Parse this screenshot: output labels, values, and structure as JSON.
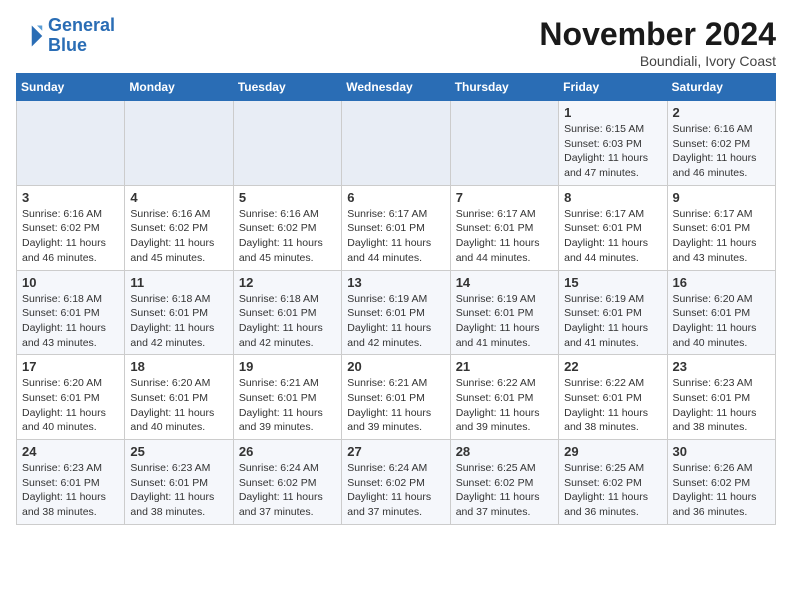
{
  "header": {
    "logo_line1": "General",
    "logo_line2": "Blue",
    "month": "November 2024",
    "location": "Boundiali, Ivory Coast"
  },
  "weekdays": [
    "Sunday",
    "Monday",
    "Tuesday",
    "Wednesday",
    "Thursday",
    "Friday",
    "Saturday"
  ],
  "weeks": [
    [
      {
        "day": "",
        "info": ""
      },
      {
        "day": "",
        "info": ""
      },
      {
        "day": "",
        "info": ""
      },
      {
        "day": "",
        "info": ""
      },
      {
        "day": "",
        "info": ""
      },
      {
        "day": "1",
        "info": "Sunrise: 6:15 AM\nSunset: 6:03 PM\nDaylight: 11 hours and 47 minutes."
      },
      {
        "day": "2",
        "info": "Sunrise: 6:16 AM\nSunset: 6:02 PM\nDaylight: 11 hours and 46 minutes."
      }
    ],
    [
      {
        "day": "3",
        "info": "Sunrise: 6:16 AM\nSunset: 6:02 PM\nDaylight: 11 hours and 46 minutes."
      },
      {
        "day": "4",
        "info": "Sunrise: 6:16 AM\nSunset: 6:02 PM\nDaylight: 11 hours and 45 minutes."
      },
      {
        "day": "5",
        "info": "Sunrise: 6:16 AM\nSunset: 6:02 PM\nDaylight: 11 hours and 45 minutes."
      },
      {
        "day": "6",
        "info": "Sunrise: 6:17 AM\nSunset: 6:01 PM\nDaylight: 11 hours and 44 minutes."
      },
      {
        "day": "7",
        "info": "Sunrise: 6:17 AM\nSunset: 6:01 PM\nDaylight: 11 hours and 44 minutes."
      },
      {
        "day": "8",
        "info": "Sunrise: 6:17 AM\nSunset: 6:01 PM\nDaylight: 11 hours and 44 minutes."
      },
      {
        "day": "9",
        "info": "Sunrise: 6:17 AM\nSunset: 6:01 PM\nDaylight: 11 hours and 43 minutes."
      }
    ],
    [
      {
        "day": "10",
        "info": "Sunrise: 6:18 AM\nSunset: 6:01 PM\nDaylight: 11 hours and 43 minutes."
      },
      {
        "day": "11",
        "info": "Sunrise: 6:18 AM\nSunset: 6:01 PM\nDaylight: 11 hours and 42 minutes."
      },
      {
        "day": "12",
        "info": "Sunrise: 6:18 AM\nSunset: 6:01 PM\nDaylight: 11 hours and 42 minutes."
      },
      {
        "day": "13",
        "info": "Sunrise: 6:19 AM\nSunset: 6:01 PM\nDaylight: 11 hours and 42 minutes."
      },
      {
        "day": "14",
        "info": "Sunrise: 6:19 AM\nSunset: 6:01 PM\nDaylight: 11 hours and 41 minutes."
      },
      {
        "day": "15",
        "info": "Sunrise: 6:19 AM\nSunset: 6:01 PM\nDaylight: 11 hours and 41 minutes."
      },
      {
        "day": "16",
        "info": "Sunrise: 6:20 AM\nSunset: 6:01 PM\nDaylight: 11 hours and 40 minutes."
      }
    ],
    [
      {
        "day": "17",
        "info": "Sunrise: 6:20 AM\nSunset: 6:01 PM\nDaylight: 11 hours and 40 minutes."
      },
      {
        "day": "18",
        "info": "Sunrise: 6:20 AM\nSunset: 6:01 PM\nDaylight: 11 hours and 40 minutes."
      },
      {
        "day": "19",
        "info": "Sunrise: 6:21 AM\nSunset: 6:01 PM\nDaylight: 11 hours and 39 minutes."
      },
      {
        "day": "20",
        "info": "Sunrise: 6:21 AM\nSunset: 6:01 PM\nDaylight: 11 hours and 39 minutes."
      },
      {
        "day": "21",
        "info": "Sunrise: 6:22 AM\nSunset: 6:01 PM\nDaylight: 11 hours and 39 minutes."
      },
      {
        "day": "22",
        "info": "Sunrise: 6:22 AM\nSunset: 6:01 PM\nDaylight: 11 hours and 38 minutes."
      },
      {
        "day": "23",
        "info": "Sunrise: 6:23 AM\nSunset: 6:01 PM\nDaylight: 11 hours and 38 minutes."
      }
    ],
    [
      {
        "day": "24",
        "info": "Sunrise: 6:23 AM\nSunset: 6:01 PM\nDaylight: 11 hours and 38 minutes."
      },
      {
        "day": "25",
        "info": "Sunrise: 6:23 AM\nSunset: 6:01 PM\nDaylight: 11 hours and 38 minutes."
      },
      {
        "day": "26",
        "info": "Sunrise: 6:24 AM\nSunset: 6:02 PM\nDaylight: 11 hours and 37 minutes."
      },
      {
        "day": "27",
        "info": "Sunrise: 6:24 AM\nSunset: 6:02 PM\nDaylight: 11 hours and 37 minutes."
      },
      {
        "day": "28",
        "info": "Sunrise: 6:25 AM\nSunset: 6:02 PM\nDaylight: 11 hours and 37 minutes."
      },
      {
        "day": "29",
        "info": "Sunrise: 6:25 AM\nSunset: 6:02 PM\nDaylight: 11 hours and 36 minutes."
      },
      {
        "day": "30",
        "info": "Sunrise: 6:26 AM\nSunset: 6:02 PM\nDaylight: 11 hours and 36 minutes."
      }
    ]
  ]
}
